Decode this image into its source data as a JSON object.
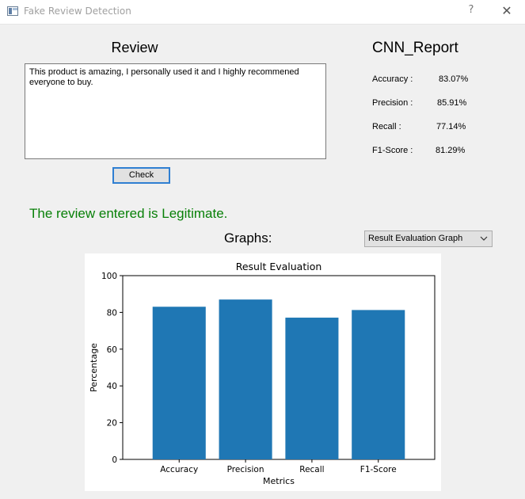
{
  "window": {
    "title": "Fake Review Detection",
    "help_label": "?",
    "close_label": "✕"
  },
  "review": {
    "heading": "Review",
    "text": "This product is amazing, I personally used it and I highly recommened everyone to buy.",
    "check_label": "Check"
  },
  "result": {
    "message": "The review entered is Legitimate.",
    "color": "#088008"
  },
  "graphs": {
    "label": "Graphs:",
    "selected": "Result Evaluation Graph"
  },
  "report": {
    "heading": "CNN_Report",
    "metrics": [
      {
        "label": "Accuracy :",
        "value": "83.07%"
      },
      {
        "label": "Precision :",
        "value": "85.91%"
      },
      {
        "label": "Recall :",
        "value": "77.14%"
      },
      {
        "label": "F1-Score :",
        "value": "81.29%"
      }
    ]
  },
  "chart_data": {
    "type": "bar",
    "title": "Result Evaluation",
    "xlabel": "Metrics",
    "ylabel": "Percentage",
    "categories": [
      "Accuracy",
      "Precision",
      "Recall",
      "F1-Score"
    ],
    "values": [
      83.07,
      87.0,
      77.14,
      81.29
    ],
    "ylim": [
      0,
      100
    ],
    "yticks": [
      0,
      20,
      40,
      60,
      80,
      100
    ],
    "bar_color": "#1f77b4",
    "grid": false
  }
}
